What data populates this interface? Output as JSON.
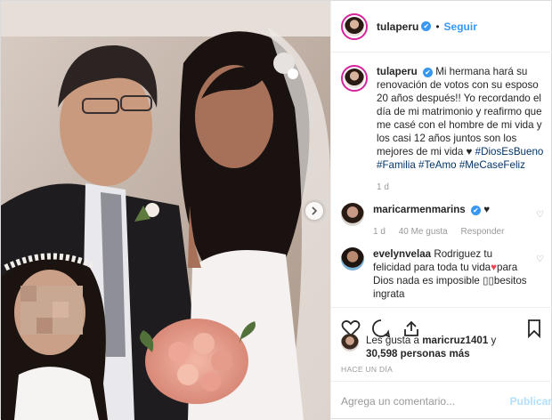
{
  "header": {
    "username": "tulaperu",
    "verified": "✔",
    "separator": "•",
    "follow_label": "Seguir"
  },
  "caption": {
    "username": "tulaperu",
    "text": "Mi hermana hará su renovación de votos con su esposo 20 años después!! Yo recordando el día de mi matrimonio y reafirmo que me casé con el hombre de mi vida y los casi 12 años juntos son los mejores de mi vida",
    "heart": "♥",
    "hashtags": [
      "#DiosEsBueno",
      "#Familia",
      "#TeAmo",
      "#MeCaseFeliz"
    ],
    "time": "1 d"
  },
  "comments": [
    {
      "username": "maricarmenmarins",
      "text": "",
      "emoji": "♥",
      "time": "1 d",
      "likes": "40 Me gusta",
      "reply": "Responder"
    },
    {
      "username": "evelynvelaa",
      "text_before": "Rodriguez tu felicidad para toda tu vida",
      "emoji": "♥",
      "text_after": "para Dios nada es imposible",
      "squares": "▯▯",
      "text_end": "besitos ingrata"
    }
  ],
  "likes": {
    "prefix": "Les gusta a",
    "user": "maricruz1401",
    "conj": "y",
    "count": "30,598 personas más"
  },
  "time_ago": "HACE UN DÍA",
  "add_comment": {
    "placeholder": "Agrega un comentario...",
    "publish": "Publicar"
  },
  "colors": {
    "link": "#3897f0",
    "hashtag": "#003569",
    "heart_red": "#ed4956",
    "muted": "#999999",
    "border": "#efefef"
  }
}
